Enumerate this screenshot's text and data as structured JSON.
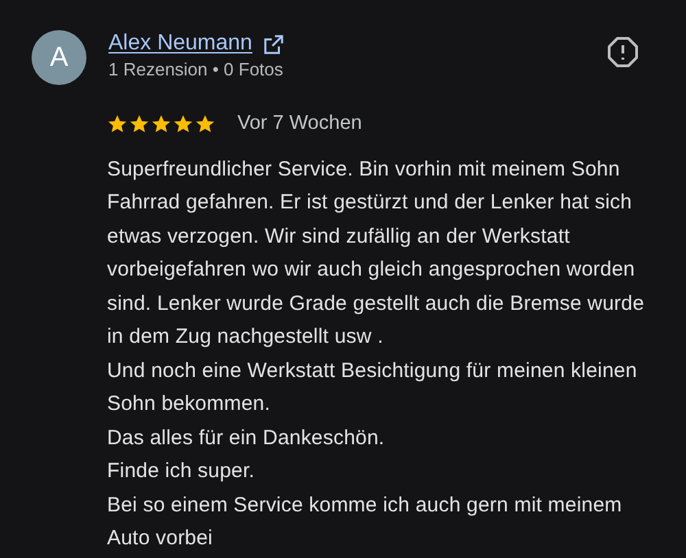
{
  "review": {
    "avatar_letter": "A",
    "author": "Alex Neumann",
    "meta": "1 Rezension • 0 Fotos",
    "stars": 5,
    "time": "Vor 7 Wochen",
    "text": "Superfreundlicher Service. Bin vorhin mit meinem Sohn Fahrrad gefahren. Er ist gestürzt und der Lenker hat sich etwas verzogen. Wir sind zufällig an der Werkstatt vorbeigefahren wo wir auch gleich angesprochen worden sind. Lenker wurde Grade gestellt auch die Bremse wurde in dem Zug nachgestellt usw .\nUnd noch eine Werkstatt Besichtigung für meinen kleinen Sohn bekommen.\nDas alles für ein Dankeschön.\nFinde ich super.\nBei so einem Service komme ich auch gern mit meinem Auto vorbei"
  }
}
